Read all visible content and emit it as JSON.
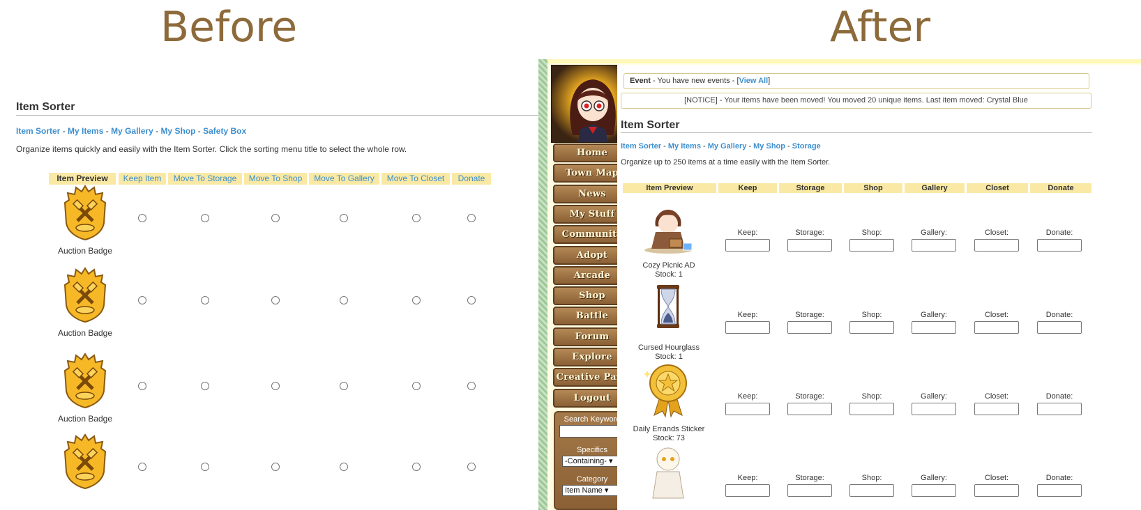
{
  "labels": {
    "before": "Before",
    "after": "After"
  },
  "before": {
    "title": "Item Sorter",
    "links": [
      "Item Sorter",
      "My Items",
      "My Gallery",
      "My Shop",
      "Safety Box"
    ],
    "description": "Organize items quickly and easily with the Item Sorter. Click the sorting menu title to select the whole row.",
    "columns": [
      "Item Preview",
      "Keep Item",
      "Move To Storage",
      "Move To Shop",
      "Move To Gallery",
      "Move To Closet",
      "Donate"
    ],
    "items": [
      {
        "name": "Auction Badge"
      },
      {
        "name": "Auction Badge"
      },
      {
        "name": "Auction Badge"
      },
      {
        "name": ""
      }
    ]
  },
  "after": {
    "nav": [
      "Home",
      "Town Map",
      "News",
      "My Stuff",
      "Community",
      "Adopt",
      "Arcade",
      "Shop",
      "Battle",
      "Forum",
      "Explore",
      "Creative Park",
      "Logout"
    ],
    "search": {
      "keyword_label": "Search Keyword",
      "specifics_label": "Specifics",
      "specifics_value": "-Containing-",
      "category_label": "Category",
      "category_value": "Item Name"
    },
    "event": {
      "label": "Event",
      "text": " - You have new events - [",
      "link": "View All",
      "close": "]"
    },
    "notice": "[NOTICE] - Your items have been moved! You moved 20 unique items. Last item moved: Crystal Blue",
    "title": "Item Sorter",
    "links": [
      "Item Sorter",
      "My Items",
      "My Gallery",
      "My Shop",
      "Storage"
    ],
    "description": "Organize up to 250 items at a time easily with the Item Sorter.",
    "columns": [
      "Item Preview",
      "Keep",
      "Storage",
      "Shop",
      "Gallery",
      "Closet",
      "Donate"
    ],
    "field_labels": [
      "Keep:",
      "Storage:",
      "Shop:",
      "Gallery:",
      "Closet:",
      "Donate:"
    ],
    "items": [
      {
        "name": "Cozy Picnic AD",
        "stock": "Stock: 1"
      },
      {
        "name": "Cursed Hourglass",
        "stock": "Stock: 1"
      },
      {
        "name": "Daily Errands Sticker",
        "stock": "Stock: 73"
      },
      {
        "name": "",
        "stock": ""
      }
    ]
  },
  "colors": {
    "link": "#3d8fcf",
    "header_bg": "#f9e9a5",
    "heading": "#8d6a3a",
    "nav_brown": "#8a6035"
  }
}
